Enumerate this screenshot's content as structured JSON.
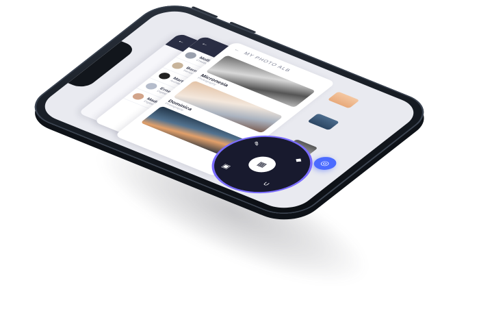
{
  "screen": {
    "album_header": "MY PHOTO ALB",
    "back_label": "←",
    "contacts": [
      {
        "name": "Mollie Stevenson",
        "sub": "Creative designer"
      },
      {
        "name": "Bernard Reese",
        "sub": "Senior manager"
      },
      {
        "name": "Martha Keller",
        "sub": "Architect"
      },
      {
        "name": "Ernest Griffith",
        "sub": "Digital marketing"
      },
      {
        "name": "Madge Hunt",
        "sub": "Digital marketing"
      }
    ],
    "photos": [
      {
        "title": "Micronesia",
        "sub": "Photography"
      },
      {
        "title": "Dominica",
        "sub": "Photography"
      },
      {
        "title": "",
        "sub": ""
      }
    ],
    "fab_icon": "camera-icon",
    "dial": {
      "center_icon": "grid-icon",
      "icons": [
        "pen-icon",
        "shape-icon",
        "image-icon",
        "magnet-icon"
      ]
    }
  }
}
